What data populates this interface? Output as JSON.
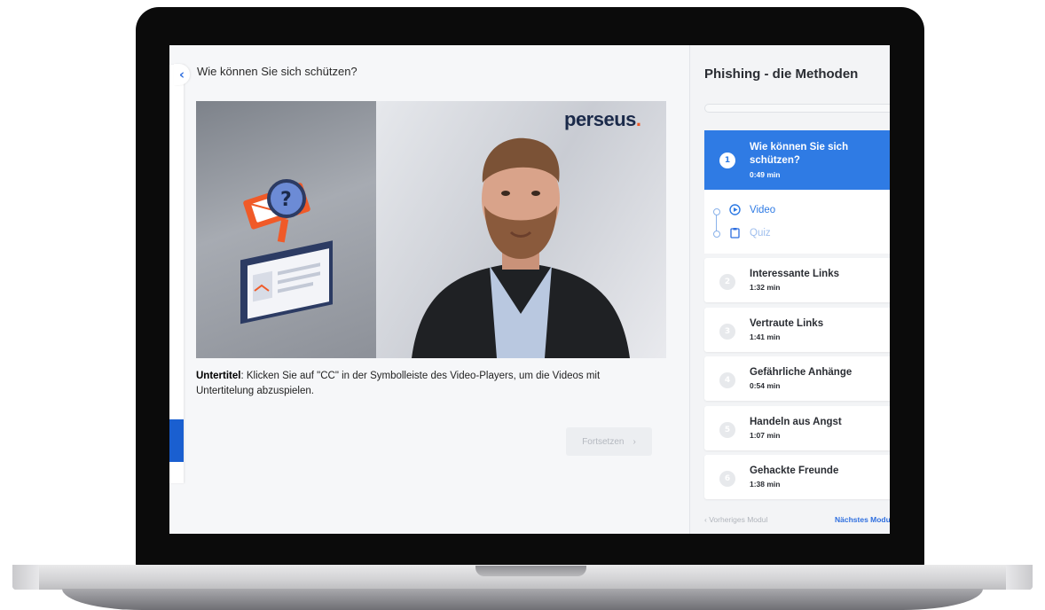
{
  "lesson": {
    "title": "Wie können Sie sich schützen?",
    "back_icon": "chevron-left",
    "video": {
      "brand": "perseus",
      "brand_dot": "."
    },
    "subtitle_label": "Untertitel",
    "subtitle_text": ": Klicken Sie auf \"CC\" in der Symbolleiste des Video-Players, um die Videos mit Untertitelung abzuspielen.",
    "continue_label": "Fortsetzen",
    "continue_icon": "chevron-right"
  },
  "sidebar": {
    "module_title": "Phishing - die Methoden",
    "active_item": {
      "number": "1",
      "title": "Wie können Sie sich schützen?",
      "duration": "0:49 min",
      "sub_items": [
        {
          "label": "Video",
          "icon": "play-circle-icon",
          "color": "#2f7be4"
        },
        {
          "label": "Quiz",
          "icon": "clipboard-icon",
          "color": "#9fbfee"
        }
      ]
    },
    "items": [
      {
        "number": "2",
        "title": "Interessante Links",
        "duration": "1:32 min"
      },
      {
        "number": "3",
        "title": "Vertraute Links",
        "duration": "1:41 min"
      },
      {
        "number": "4",
        "title": "Gefährliche Anhänge",
        "duration": "0:54 min"
      },
      {
        "number": "5",
        "title": "Handeln aus Angst",
        "duration": "1:07 min"
      },
      {
        "number": "6",
        "title": "Gehackte Freunde",
        "duration": "1:38 min"
      }
    ],
    "prev_label": "Vorheriges Modul",
    "next_label": "Nächstes Modul"
  },
  "colors": {
    "accent": "#2f7be4",
    "brand_orange": "#f05a28",
    "brand_navy": "#1b2a4a"
  }
}
